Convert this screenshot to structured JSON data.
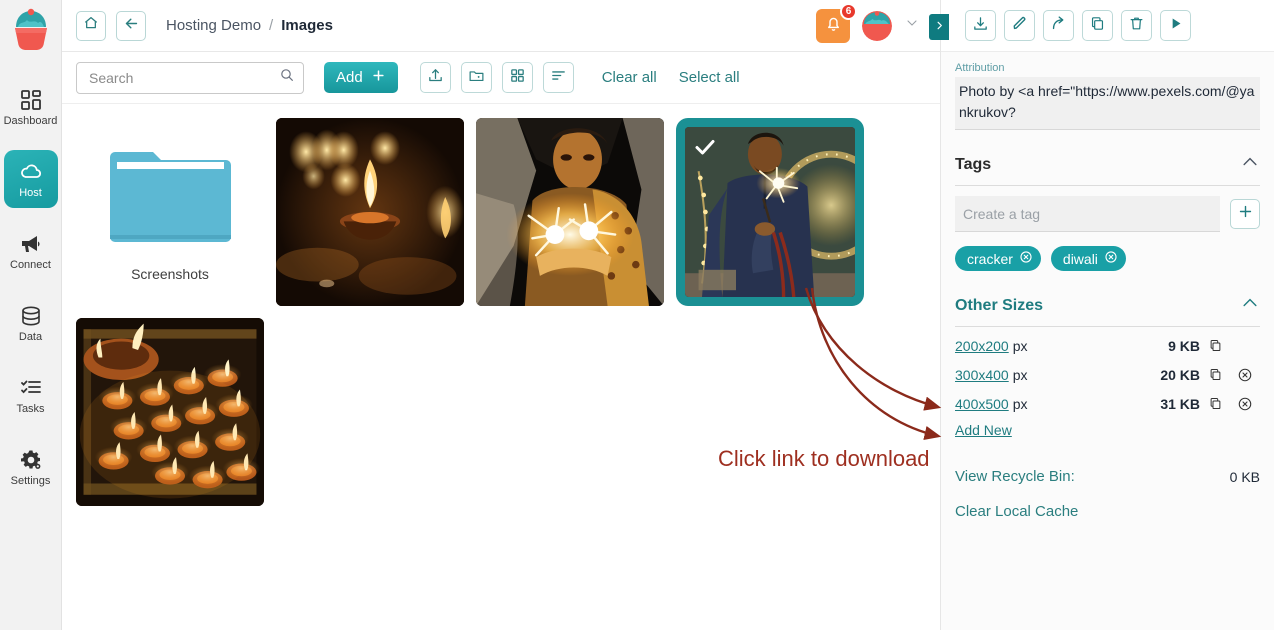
{
  "app": {
    "logo_icon": "cupcake-logo"
  },
  "sidebar": {
    "items": [
      {
        "label": "Dashboard",
        "icon": "dashboard-grid-icon",
        "active": false
      },
      {
        "label": "Host",
        "icon": "cloud-icon",
        "active": true
      },
      {
        "label": "Connect",
        "icon": "megaphone-icon",
        "active": false
      },
      {
        "label": "Data",
        "icon": "database-icon",
        "active": false
      },
      {
        "label": "Tasks",
        "icon": "checklist-icon",
        "active": false
      },
      {
        "label": "Settings",
        "icon": "gear-icon",
        "active": false
      }
    ]
  },
  "topbar": {
    "home_icon": "home-icon",
    "back_icon": "arrow-left-icon",
    "breadcrumb": {
      "root": "Hosting Demo",
      "separator": "/",
      "current": "Images"
    },
    "notifications": {
      "icon": "bell-icon",
      "count": "6",
      "badge_color": "#e8392c",
      "button_color": "#f5923e"
    },
    "avatar_icon": "cupcake-avatar",
    "chevron_icon": "chevron-down-icon"
  },
  "actionbar": {
    "search": {
      "placeholder": "Search",
      "value": "",
      "icon": "search-icon"
    },
    "add_label": "Add",
    "add_icon": "plus-icon",
    "upload_icon": "upload-icon",
    "new_folder_icon": "new-folder-icon",
    "grid_view_icon": "grid-view-icon",
    "sort_icon": "sort-icon",
    "clear_all_label": "Clear all",
    "select_all_label": "Select all"
  },
  "grid": {
    "folders": [
      {
        "name": "Screenshots",
        "icon": "folder-icon"
      }
    ],
    "images": [
      {
        "alt": "diya-candles-bokeh",
        "selected": false
      },
      {
        "alt": "woman-holding-sparklers",
        "selected": false
      },
      {
        "alt": "man-holding-sparkler",
        "selected": true,
        "check_icon": "check-icon"
      },
      {
        "alt": "tray-of-oil-lamps",
        "selected": false
      }
    ]
  },
  "annotation": {
    "text": "Click link to download",
    "color": "#9e2f20"
  },
  "panel": {
    "toggle_icon": "chevron-right-icon",
    "toolbar": [
      {
        "icon": "download-icon",
        "name": "download-button"
      },
      {
        "icon": "edit-pencil-icon",
        "name": "edit-button"
      },
      {
        "icon": "share-arrow-icon",
        "name": "share-button"
      },
      {
        "icon": "copy-icon",
        "name": "copy-button"
      },
      {
        "icon": "trash-icon",
        "name": "delete-button"
      },
      {
        "icon": "play-icon",
        "name": "play-button"
      }
    ],
    "attribution": {
      "label": "Attribution",
      "value": "Photo by <a href=\"https://www.pexels.com/@yankrukov?"
    },
    "tags": {
      "title": "Tags",
      "collapse_icon": "chevron-up-icon",
      "input_placeholder": "Create a tag",
      "input_value": "",
      "add_icon": "plus-icon",
      "chips": [
        {
          "label": "cracker",
          "remove_icon": "remove-circle-icon"
        },
        {
          "label": "diwali",
          "remove_icon": "remove-circle-icon"
        }
      ]
    },
    "other_sizes": {
      "title": "Other Sizes",
      "collapse_icon": "chevron-up-icon",
      "rows": [
        {
          "size": "200x200",
          "unit": "px",
          "filesize": "9 KB",
          "copy_icon": "copy-icon",
          "delete_icon": null
        },
        {
          "size": "300x400",
          "unit": "px",
          "filesize": "20 KB",
          "copy_icon": "copy-icon",
          "delete_icon": "remove-circle-icon"
        },
        {
          "size": "400x500",
          "unit": "px",
          "filesize": "31 KB",
          "copy_icon": "copy-icon",
          "delete_icon": "remove-circle-icon"
        }
      ],
      "add_new_label": "Add New"
    },
    "recycle_bin": {
      "label": "View Recycle Bin:",
      "size": "0 KB"
    },
    "clear_cache_label": "Clear Local Cache"
  },
  "colors": {
    "accent_teal": "#19a0a6",
    "dark_teal": "#1f7c80",
    "selection": "#1b9094",
    "annotation_red": "#9e2f20",
    "orange": "#f5923e"
  }
}
